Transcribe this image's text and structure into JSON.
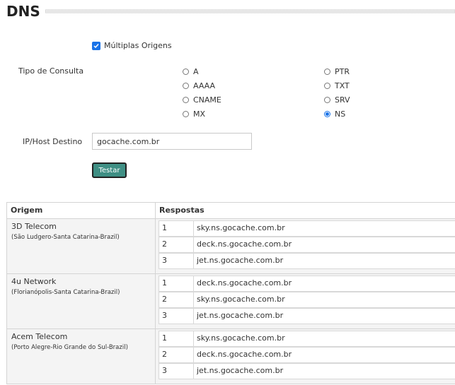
{
  "page": {
    "title": "DNS"
  },
  "multiple_origins": {
    "label": "Múltiplas Origens",
    "checked": true
  },
  "query_type": {
    "label": "Tipo de Consulta",
    "options": [
      "A",
      "AAAA",
      "CNAME",
      "MX",
      "PTR",
      "TXT",
      "SRV",
      "NS"
    ],
    "selected": "NS"
  },
  "target": {
    "label": "IP/Host Destino",
    "value": "gocache.com.br"
  },
  "test_button": {
    "label": "Testar"
  },
  "results": {
    "headers": [
      "Origem",
      "Respostas"
    ],
    "rows": [
      {
        "name": "3D Telecom",
        "location": "(São Ludgero-Santa Catarina-Brazil)",
        "answers": [
          {
            "n": "1",
            "v": "sky.ns.gocache.com.br"
          },
          {
            "n": "2",
            "v": "deck.ns.gocache.com.br"
          },
          {
            "n": "3",
            "v": "jet.ns.gocache.com.br"
          }
        ]
      },
      {
        "name": "4u Network",
        "location": "(Florianópolis-Santa Catarina-Brazil)",
        "answers": [
          {
            "n": "1",
            "v": "deck.ns.gocache.com.br"
          },
          {
            "n": "2",
            "v": "sky.ns.gocache.com.br"
          },
          {
            "n": "3",
            "v": "jet.ns.gocache.com.br"
          }
        ]
      },
      {
        "name": "Acem Telecom",
        "location": "(Porto Alegre-Rio Grande do Sul-Brazil)",
        "answers": [
          {
            "n": "1",
            "v": "sky.ns.gocache.com.br"
          },
          {
            "n": "2",
            "v": "deck.ns.gocache.com.br"
          },
          {
            "n": "3",
            "v": "jet.ns.gocache.com.br"
          }
        ]
      }
    ]
  }
}
